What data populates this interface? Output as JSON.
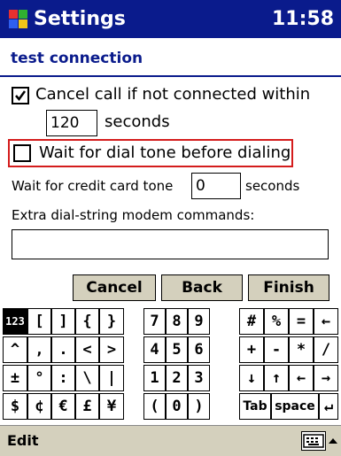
{
  "titlebar": {
    "title": "Settings",
    "clock": "11:58"
  },
  "page": {
    "header": "test connection"
  },
  "form": {
    "cancel_call": {
      "checked": true,
      "label": "Cancel call if not connected within"
    },
    "timeout": {
      "value": "120",
      "unit": "seconds"
    },
    "wait_dial_tone": {
      "checked": false,
      "label": "Wait for dial tone before dialing"
    },
    "credit_card": {
      "label": "Wait for credit card tone",
      "value": "0",
      "unit": "seconds"
    },
    "extra_commands": {
      "label": "Extra dial-string modem commands:",
      "value": ""
    }
  },
  "buttons": {
    "cancel": "Cancel",
    "back": "Back",
    "finish": "Finish"
  },
  "keyboard": {
    "row1": [
      "123",
      "[",
      "]",
      "{",
      "}",
      "7",
      "8",
      "9",
      "#",
      "%",
      "=",
      "←"
    ],
    "row2": [
      "^",
      ",",
      ".",
      "<",
      ">",
      "4",
      "5",
      "6",
      "+",
      "-",
      "*",
      "/"
    ],
    "row3": [
      "±",
      "°",
      ":",
      "\\",
      "|",
      "1",
      "2",
      "3",
      "↓",
      "↑",
      "←",
      "→"
    ],
    "row4": [
      "$",
      "¢",
      "€",
      "£",
      "¥",
      "(",
      "0",
      ")",
      "Tab",
      "space",
      "↵"
    ]
  },
  "bottombar": {
    "menu": "Edit"
  },
  "colors": {
    "titlebar": "#0a1b8c",
    "highlight": "#d41c1c",
    "button_bg": "#d4d0bd"
  }
}
